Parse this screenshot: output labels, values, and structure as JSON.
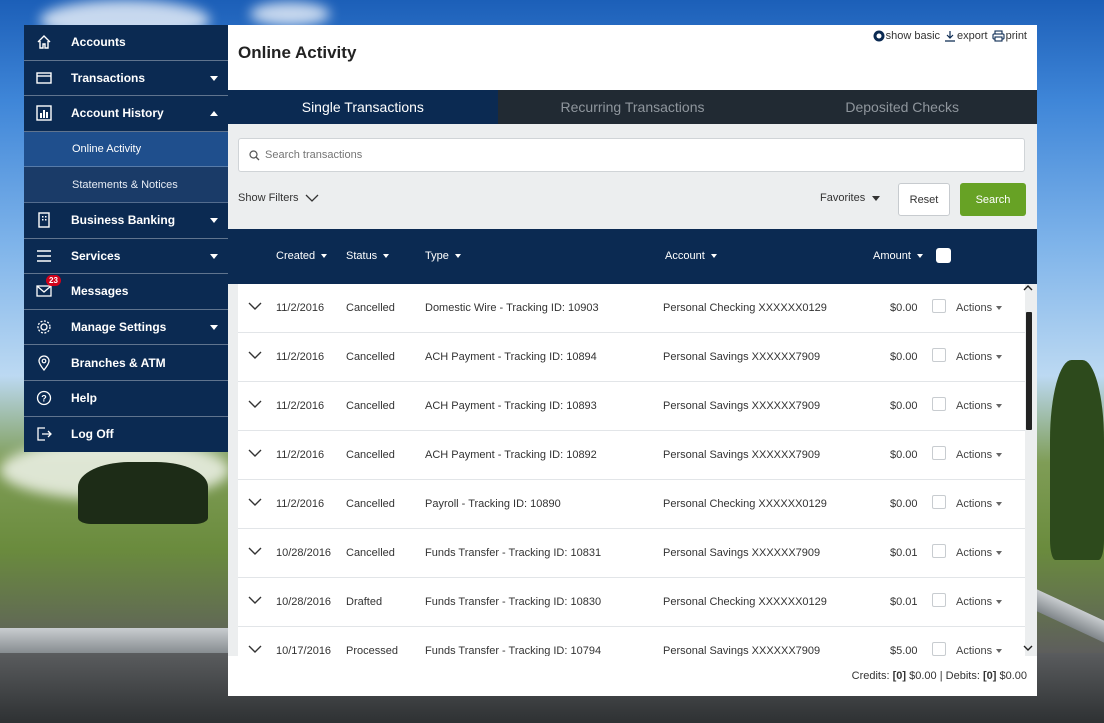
{
  "sidebar": {
    "items": [
      {
        "label": "Accounts"
      },
      {
        "label": "Transactions"
      },
      {
        "label": "Account History"
      },
      {
        "label": "Online Activity"
      },
      {
        "label": "Statements & Notices"
      },
      {
        "label": "Business Banking"
      },
      {
        "label": "Services"
      },
      {
        "label": "Messages",
        "badge": "23"
      },
      {
        "label": "Manage Settings"
      },
      {
        "label": "Branches & ATM"
      },
      {
        "label": "Help"
      },
      {
        "label": "Log Off"
      }
    ]
  },
  "header": {
    "title": "Online Activity",
    "links": {
      "show_basic": "show basic",
      "export": "export",
      "print": "print"
    }
  },
  "tabs": [
    {
      "label": "Single Transactions",
      "active": true
    },
    {
      "label": "Recurring Transactions",
      "active": false
    },
    {
      "label": "Deposited Checks",
      "active": false
    }
  ],
  "search": {
    "placeholder": "Search transactions"
  },
  "filters": {
    "show_filters": "Show Filters",
    "favorites": "Favorites",
    "reset": "Reset",
    "search": "Search"
  },
  "table": {
    "columns": {
      "created": "Created",
      "status": "Status",
      "type": "Type",
      "account": "Account",
      "amount": "Amount"
    },
    "rows": [
      {
        "created": "11/2/2016",
        "status": "Cancelled",
        "type": "Domestic Wire - Tracking ID: 10903",
        "account": "Personal Checking XXXXXX0129",
        "amount": "$0.00",
        "actions": "Actions"
      },
      {
        "created": "11/2/2016",
        "status": "Cancelled",
        "type": "ACH Payment - Tracking ID: 10894",
        "account": "Personal Savings XXXXXX7909",
        "amount": "$0.00",
        "actions": "Actions"
      },
      {
        "created": "11/2/2016",
        "status": "Cancelled",
        "type": "ACH Payment - Tracking ID: 10893",
        "account": "Personal Savings XXXXXX7909",
        "amount": "$0.00",
        "actions": "Actions"
      },
      {
        "created": "11/2/2016",
        "status": "Cancelled",
        "type": "ACH Payment - Tracking ID: 10892",
        "account": "Personal Savings XXXXXX7909",
        "amount": "$0.00",
        "actions": "Actions"
      },
      {
        "created": "11/2/2016",
        "status": "Cancelled",
        "type": "Payroll - Tracking ID: 10890",
        "account": "Personal Checking XXXXXX0129",
        "amount": "$0.00",
        "actions": "Actions"
      },
      {
        "created": "10/28/2016",
        "status": "Cancelled",
        "type": "Funds Transfer - Tracking ID: 10831",
        "account": "Personal Savings XXXXXX7909",
        "amount": "$0.01",
        "actions": "Actions"
      },
      {
        "created": "10/28/2016",
        "status": "Drafted",
        "type": "Funds Transfer - Tracking ID: 10830",
        "account": "Personal Checking XXXXXX0129",
        "amount": "$0.01",
        "actions": "Actions"
      },
      {
        "created": "10/17/2016",
        "status": "Processed",
        "type": "Funds Transfer - Tracking ID: 10794",
        "account": "Personal Savings XXXXXX7909",
        "amount": "$5.00",
        "actions": "Actions"
      }
    ]
  },
  "totals": {
    "credits_label": "Credits:",
    "credits_count": "[0]",
    "credits_amount": "$0.00",
    "separator": "|",
    "debits_label": "Debits:",
    "debits_count": "[0]",
    "debits_amount": "$0.00"
  },
  "colors": {
    "nav_bg": "#0b2a52",
    "search_button": "#67a225",
    "badge": "#d0021b"
  }
}
